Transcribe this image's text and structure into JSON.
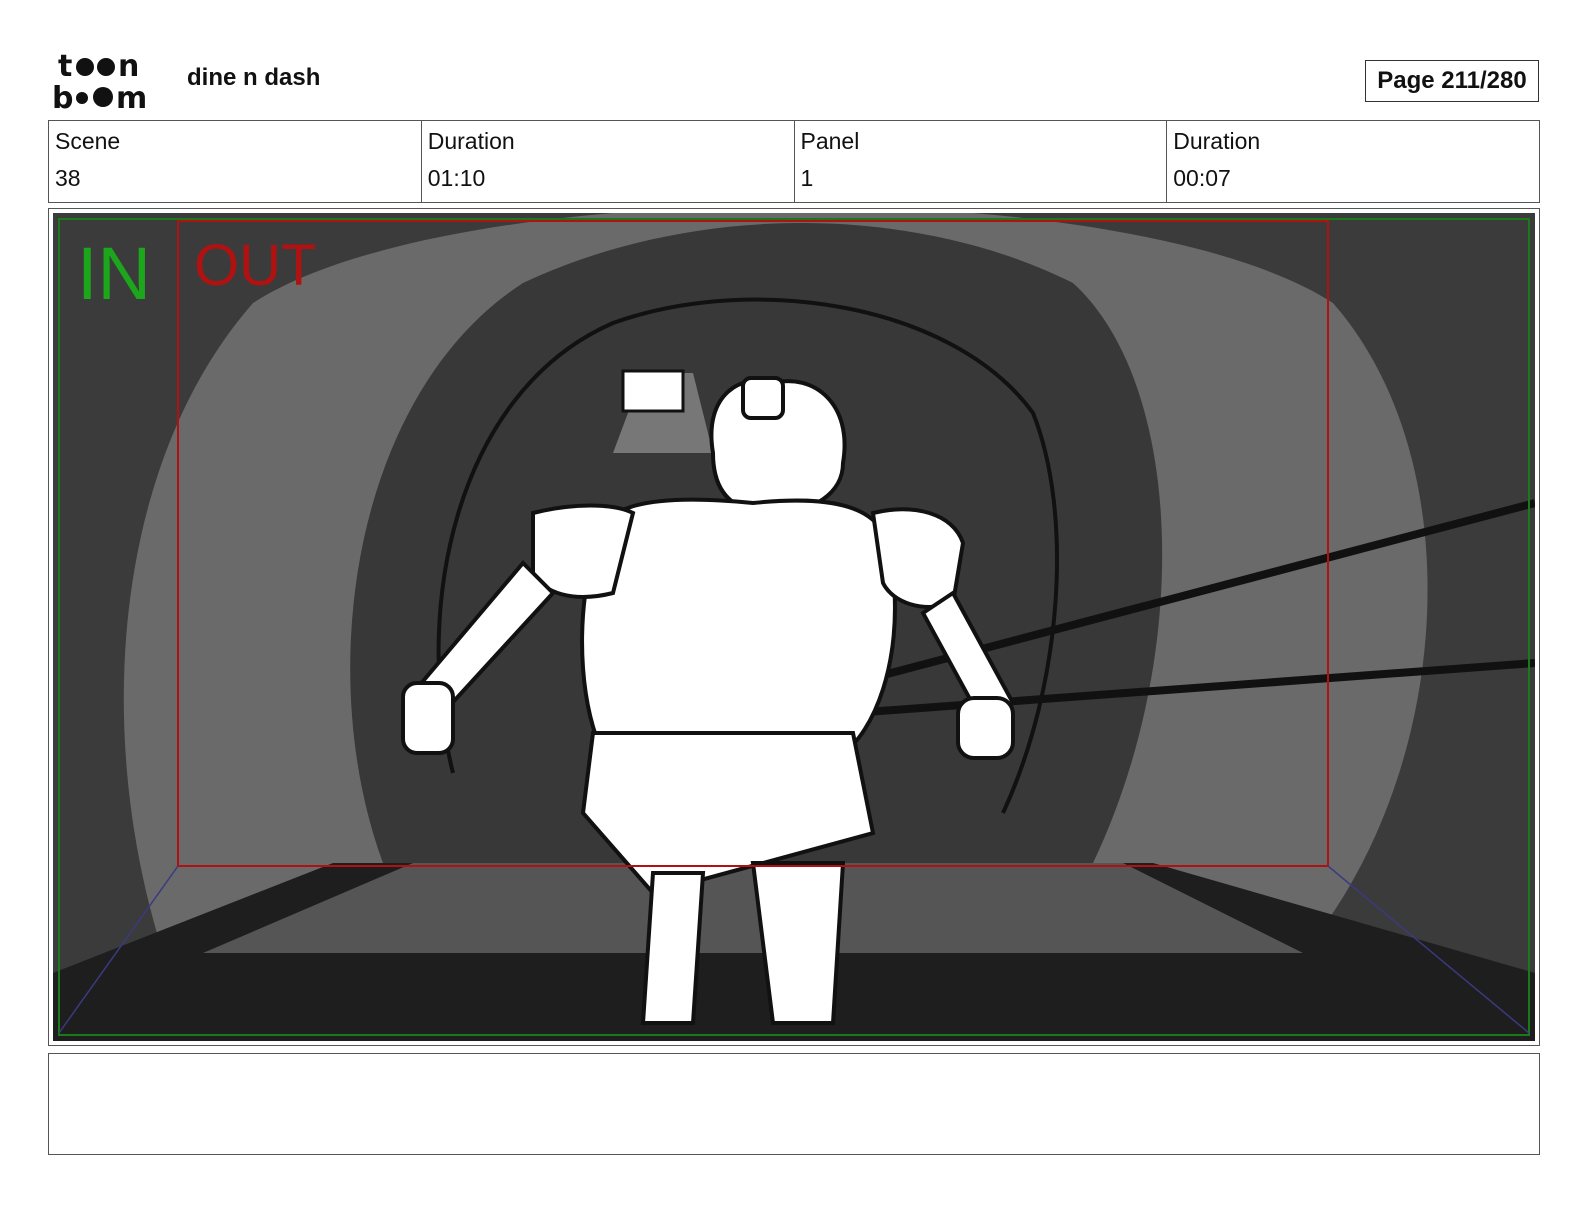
{
  "header": {
    "logo_text": "toon boom",
    "project_title": "dine n dash",
    "page_label": "Page 211/280"
  },
  "info": [
    {
      "label": "Scene",
      "value": "38"
    },
    {
      "label": "Duration",
      "value": "01:10"
    },
    {
      "label": "Panel",
      "value": "1"
    },
    {
      "label": "Duration",
      "value": "00:07"
    }
  ],
  "panel": {
    "in_label": "IN",
    "out_label": "OUT",
    "in_color": "#1ca61c",
    "out_color": "#b01212"
  },
  "notes": ""
}
